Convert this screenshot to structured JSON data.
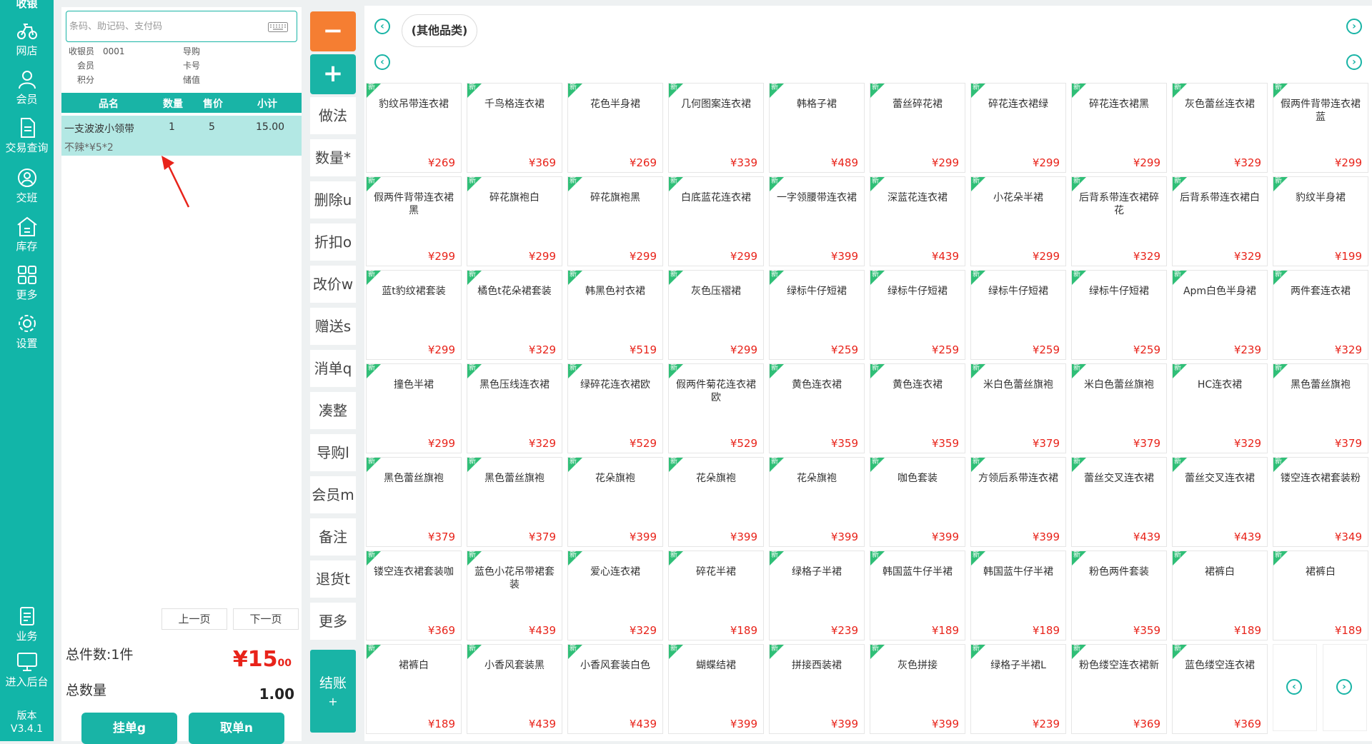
{
  "nav": {
    "head": "收银",
    "items": [
      "网店",
      "会员",
      "交易查询",
      "交班",
      "库存",
      "更多",
      "设置"
    ],
    "bottom": [
      "业务",
      "进入后台"
    ],
    "version_label": "版本",
    "version": "V3.4.1"
  },
  "search": {
    "placeholder": "条码、助记码、支付码"
  },
  "info": {
    "cashier_label": "收银员",
    "cashier_no": "0001",
    "guide_label": "导购",
    "member_label": "会员",
    "card_label": "卡号",
    "points_label": "积分",
    "balance_label": "储值"
  },
  "table": {
    "headers": [
      "品名",
      "数量",
      "售价",
      "小计"
    ],
    "rows": [
      {
        "name": "一支波波小领带",
        "qty": "1",
        "price": "5",
        "subtotal": "15.00",
        "note": "不辣*¥5*2"
      }
    ]
  },
  "pager": {
    "prev": "上一页",
    "next": "下一页"
  },
  "totals": {
    "count_label": "总件数:1件",
    "amount_int": "¥15",
    "amount_dec": "00",
    "qty_label": "总数量",
    "qty_value": "1.00"
  },
  "actions": {
    "hold": "挂单g",
    "retrieve": "取单n"
  },
  "functions": {
    "minus": "−",
    "plus": "+",
    "buttons": [
      "做法",
      "数量*",
      "删除u",
      "折扣o",
      "改价w",
      "赠送s",
      "消单q",
      "凑整",
      "导购l",
      "会员m",
      "备注",
      "退货t",
      "更多"
    ],
    "pay": "结账",
    "pay_sub": "+"
  },
  "category": {
    "current": "(其他品类)"
  },
  "new_tag": "新",
  "products": [
    {
      "name": "豹纹吊带连衣裙",
      "price": "¥269"
    },
    {
      "name": "千鸟格连衣裙",
      "price": "¥369"
    },
    {
      "name": "花色半身裙",
      "price": "¥269"
    },
    {
      "name": "几何图案连衣裙",
      "price": "¥339"
    },
    {
      "name": "韩格子裙",
      "price": "¥489"
    },
    {
      "name": "蕾丝碎花裙",
      "price": "¥299"
    },
    {
      "name": "碎花连衣裙绿",
      "price": "¥299"
    },
    {
      "name": "碎花连衣裙黑",
      "price": "¥299"
    },
    {
      "name": "灰色蕾丝连衣裙",
      "price": "¥329"
    },
    {
      "name": "假两件背带连衣裙蓝",
      "price": "¥299"
    },
    {
      "name": "假两件背带连衣裙黑",
      "price": "¥299"
    },
    {
      "name": "碎花旗袍白",
      "price": "¥299"
    },
    {
      "name": "碎花旗袍黑",
      "price": "¥299"
    },
    {
      "name": "白底蓝花连衣裙",
      "price": "¥299"
    },
    {
      "name": "一字领腰带连衣裙",
      "price": "¥399"
    },
    {
      "name": "深蓝花连衣裙",
      "price": "¥439"
    },
    {
      "name": "小花朵半裙",
      "price": "¥299"
    },
    {
      "name": "后背系带连衣裙碎花",
      "price": "¥329"
    },
    {
      "name": "后背系带连衣裙白",
      "price": "¥329"
    },
    {
      "name": "豹纹半身裙",
      "price": "¥199"
    },
    {
      "name": "蓝t豹纹裙套装",
      "price": "¥299"
    },
    {
      "name": "橘色t花朵裙套装",
      "price": "¥329"
    },
    {
      "name": "韩黑色衬衣裙",
      "price": "¥519"
    },
    {
      "name": "灰色压褶裙",
      "price": "¥299"
    },
    {
      "name": "绿标牛仔短裙",
      "price": "¥259"
    },
    {
      "name": "绿标牛仔短裙",
      "price": "¥259"
    },
    {
      "name": "绿标牛仔短裙",
      "price": "¥259"
    },
    {
      "name": "绿标牛仔短裙",
      "price": "¥259"
    },
    {
      "name": "Apm白色半身裙",
      "price": "¥239"
    },
    {
      "name": "两件套连衣裙",
      "price": "¥329"
    },
    {
      "name": "撞色半裙",
      "price": "¥299"
    },
    {
      "name": "黑色压线连衣裙",
      "price": "¥329"
    },
    {
      "name": "绿碎花连衣裙欧",
      "price": "¥529"
    },
    {
      "name": "假两件菊花连衣裙欧",
      "price": "¥529"
    },
    {
      "name": "黄色连衣裙",
      "price": "¥359"
    },
    {
      "name": "黄色连衣裙",
      "price": "¥359"
    },
    {
      "name": "米白色蕾丝旗袍",
      "price": "¥379"
    },
    {
      "name": "米白色蕾丝旗袍",
      "price": "¥379"
    },
    {
      "name": "HC连衣裙",
      "price": "¥329"
    },
    {
      "name": "黑色蕾丝旗袍",
      "price": "¥379"
    },
    {
      "name": "黑色蕾丝旗袍",
      "price": "¥379"
    },
    {
      "name": "黑色蕾丝旗袍",
      "price": "¥379"
    },
    {
      "name": "花朵旗袍",
      "price": "¥399"
    },
    {
      "name": "花朵旗袍",
      "price": "¥399"
    },
    {
      "name": "花朵旗袍",
      "price": "¥399"
    },
    {
      "name": "咖色套装",
      "price": "¥399"
    },
    {
      "name": "方领后系带连衣裙",
      "price": "¥399"
    },
    {
      "name": "蕾丝交叉连衣裙",
      "price": "¥439"
    },
    {
      "name": "蕾丝交叉连衣裙",
      "price": "¥439"
    },
    {
      "name": "镂空连衣裙套装粉",
      "price": "¥349"
    },
    {
      "name": "镂空连衣裙套装咖",
      "price": "¥369"
    },
    {
      "name": "蓝色小花吊带裙套装",
      "price": "¥439"
    },
    {
      "name": "爱心连衣裙",
      "price": "¥329"
    },
    {
      "name": "碎花半裙",
      "price": "¥189"
    },
    {
      "name": "绿格子半裙",
      "price": "¥239"
    },
    {
      "name": "韩国蓝牛仔半裙",
      "price": "¥189"
    },
    {
      "name": "韩国蓝牛仔半裙",
      "price": "¥189"
    },
    {
      "name": "粉色两件套装",
      "price": "¥359"
    },
    {
      "name": "裙裤白",
      "price": "¥189"
    },
    {
      "name": "裙裤白",
      "price": "¥189"
    },
    {
      "name": "裙裤白",
      "price": "¥189"
    },
    {
      "name": "小香风套装黑",
      "price": "¥439"
    },
    {
      "name": "小香风套装白色",
      "price": "¥439"
    },
    {
      "name": "蝴蝶结裙",
      "price": "¥399"
    },
    {
      "name": "拼接西装裙",
      "price": "¥399"
    },
    {
      "name": "灰色拼接",
      "price": "¥399"
    },
    {
      "name": "绿格子半裙L",
      "price": "¥239"
    },
    {
      "name": "粉色缕空连衣裙新",
      "price": "¥369"
    },
    {
      "name": "蓝色缕空连衣裙",
      "price": "¥369"
    }
  ],
  "arrows": {
    "left": "‹",
    "right": "›"
  }
}
